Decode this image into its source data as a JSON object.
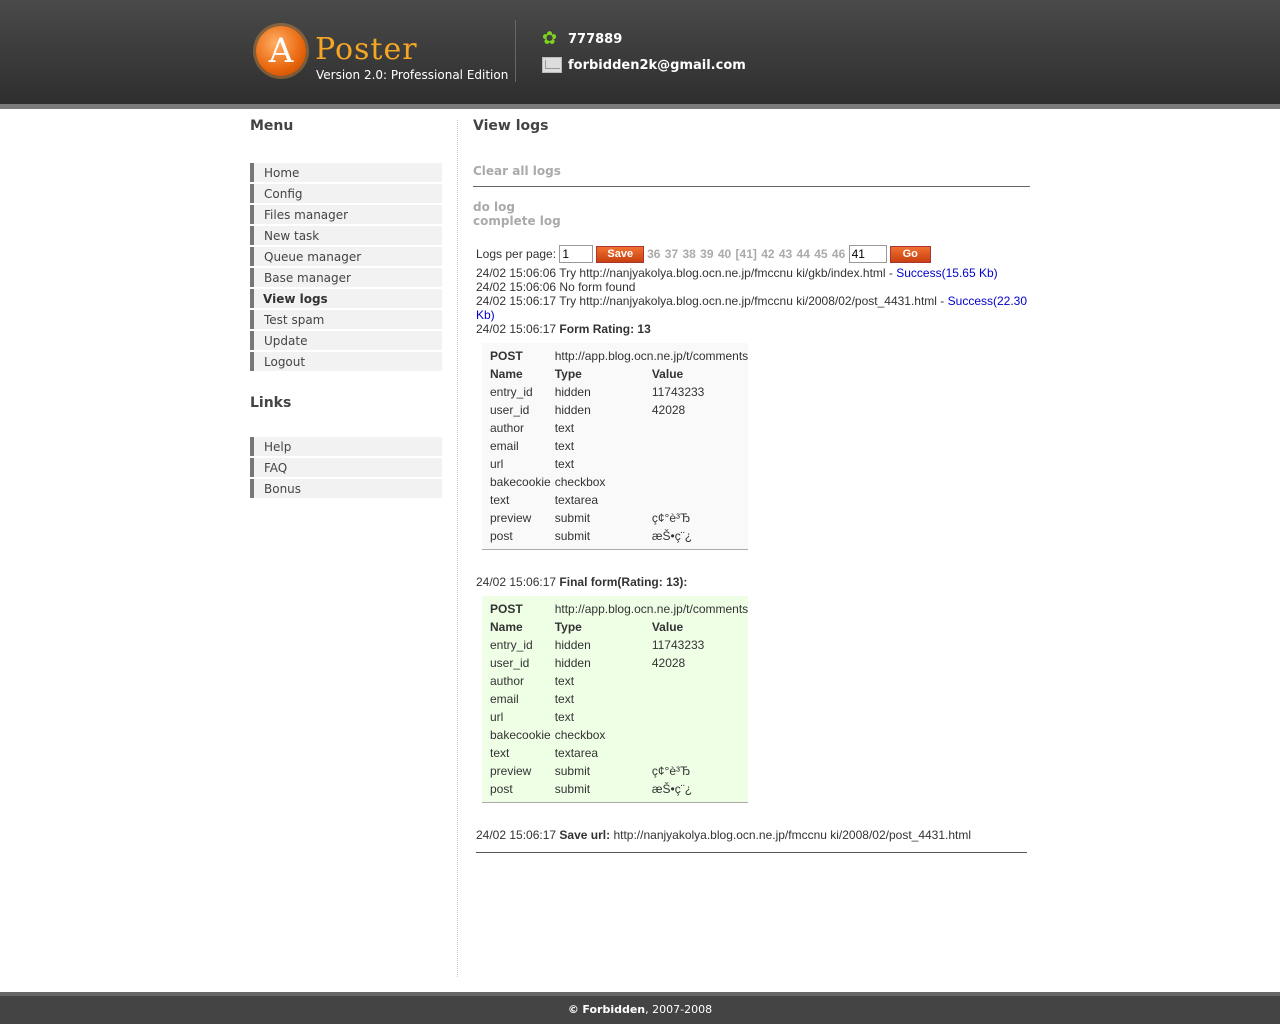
{
  "header": {
    "logo_letter": "A",
    "logo_title": "Poster",
    "version": "Version 2.0: Professional Edition",
    "icq": "777889",
    "email": "forbidden2k@gmail.com"
  },
  "sidebar": {
    "menu_heading": "Menu",
    "menu": [
      "Home",
      "Config",
      "Files manager",
      "New task",
      "Queue manager",
      "Base manager",
      "View logs",
      "Test spam",
      "Update",
      "Logout"
    ],
    "active": "View logs",
    "links_heading": "Links",
    "links": [
      "Help",
      "FAQ",
      "Bonus"
    ]
  },
  "main": {
    "title": "View logs",
    "clear_link": "Clear all logs",
    "do_log": "do log",
    "complete_log": "complete log",
    "pager": {
      "label": "Logs per page:",
      "per_page_value": "1",
      "save_label": "Save",
      "pages": "36 37 38 39 40 [41] 42 43 44 45 46",
      "goto_value": "41",
      "go_label": "Go"
    },
    "log": {
      "l1_text": "24/02 15:06:06 Try http://nanjyakolya.blog.ocn.ne.jp/fmccnu ki/gkb/index.html - ",
      "l1_status": "Success(15.65 Kb)",
      "l2_text": "24/02 15:06:06 No form found",
      "l3_text": "24/02 15:06:17 Try http://nanjyakolya.blog.ocn.ne.jp/fmccnu ki/2008/02/post_4431.html - ",
      "l3_status": "Success(22.30 Kb)",
      "l4_time": "24/02 15:06:17 ",
      "l4_bold": "Form Rating: 13",
      "l5_time": "24/02 15:06:17 ",
      "l5_bold": "Final form(Rating: 13):",
      "l6_time": "24/02 15:06:17 ",
      "l6_bold": "Save url:",
      "l6_url": " http://nanjyakolya.blog.ocn.ne.jp/fmccnu ki/2008/02/post_4431.html"
    },
    "form": {
      "method": "POST",
      "action": "http://app.blog.ocn.ne.jp/t/comments",
      "headers": [
        "Name",
        "Type",
        "Value"
      ],
      "fields": [
        {
          "name": "entry_id",
          "type": "hidden",
          "value": "11743233"
        },
        {
          "name": "user_id",
          "type": "hidden",
          "value": "42028"
        },
        {
          "name": "author",
          "type": "text",
          "value": ""
        },
        {
          "name": "email",
          "type": "text",
          "value": ""
        },
        {
          "name": "url",
          "type": "text",
          "value": ""
        },
        {
          "name": "bakecookie",
          "type": "checkbox",
          "value": ""
        },
        {
          "name": "text",
          "type": "textarea",
          "value": ""
        },
        {
          "name": "preview",
          "type": "submit",
          "value": "ç¢°è³Ђ"
        },
        {
          "name": "post",
          "type": "submit",
          "value": "æŠ•ç¨¿"
        }
      ]
    }
  },
  "footer": {
    "copy_symbol": "©",
    "brand": "Forbidden",
    "years": ", 2007-2008"
  }
}
